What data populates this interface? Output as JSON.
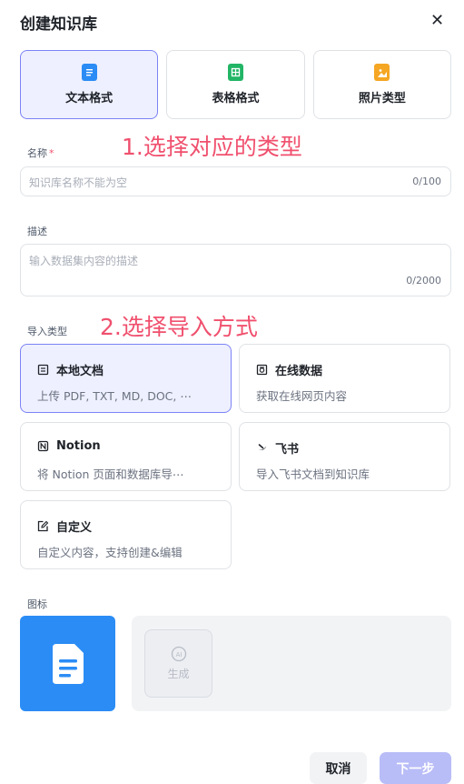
{
  "dialog": {
    "title": "创建知识库",
    "close": "✕"
  },
  "formats": [
    {
      "label": "文本格式",
      "color": "#2b8cf5",
      "icon": "document-icon",
      "active": true
    },
    {
      "label": "表格格式",
      "color": "#22b566",
      "icon": "table-icon",
      "active": false
    },
    {
      "label": "照片类型",
      "color": "#f5a623",
      "icon": "image-icon",
      "active": false
    }
  ],
  "annotations": {
    "step1": "1.选择对应的类型",
    "step2": "2.选择导入方式"
  },
  "name_field": {
    "label": "名称",
    "required_mark": "*",
    "placeholder": "知识库名称不能为空",
    "counter": "0/100"
  },
  "description_field": {
    "label": "描述",
    "placeholder": "输入数据集内容的描述",
    "counter": "0/2000"
  },
  "import_type": {
    "label": "导入类型",
    "options": [
      {
        "title": "本地文档",
        "desc": "上传 PDF, TXT, MD, DOC, ⋯",
        "icon": "local-document-icon",
        "active": true
      },
      {
        "title": "在线数据",
        "desc": "获取在线网页内容",
        "icon": "online-data-icon",
        "active": false
      },
      {
        "title": "Notion",
        "desc": "将 Notion 页面和数据库导⋯",
        "icon": "notion-icon",
        "active": false
      },
      {
        "title": "飞书",
        "desc": "导入飞书文档到知识库",
        "icon": "feishu-icon",
        "active": false
      },
      {
        "title": "自定义",
        "desc": "自定义内容，支持创建&编辑",
        "icon": "custom-edit-icon",
        "active": false
      }
    ]
  },
  "icon_section": {
    "label": "图标",
    "ai_badge": "AI",
    "ai_label": "生成",
    "accent": "#2b8cf5"
  },
  "footer": {
    "cancel": "取消",
    "next": "下一步"
  },
  "colors": {
    "annotation": "#f0506e",
    "active_border": "#7c83f5",
    "active_bg": "#eef0ff",
    "next_disabled": "#b8bcf7"
  }
}
